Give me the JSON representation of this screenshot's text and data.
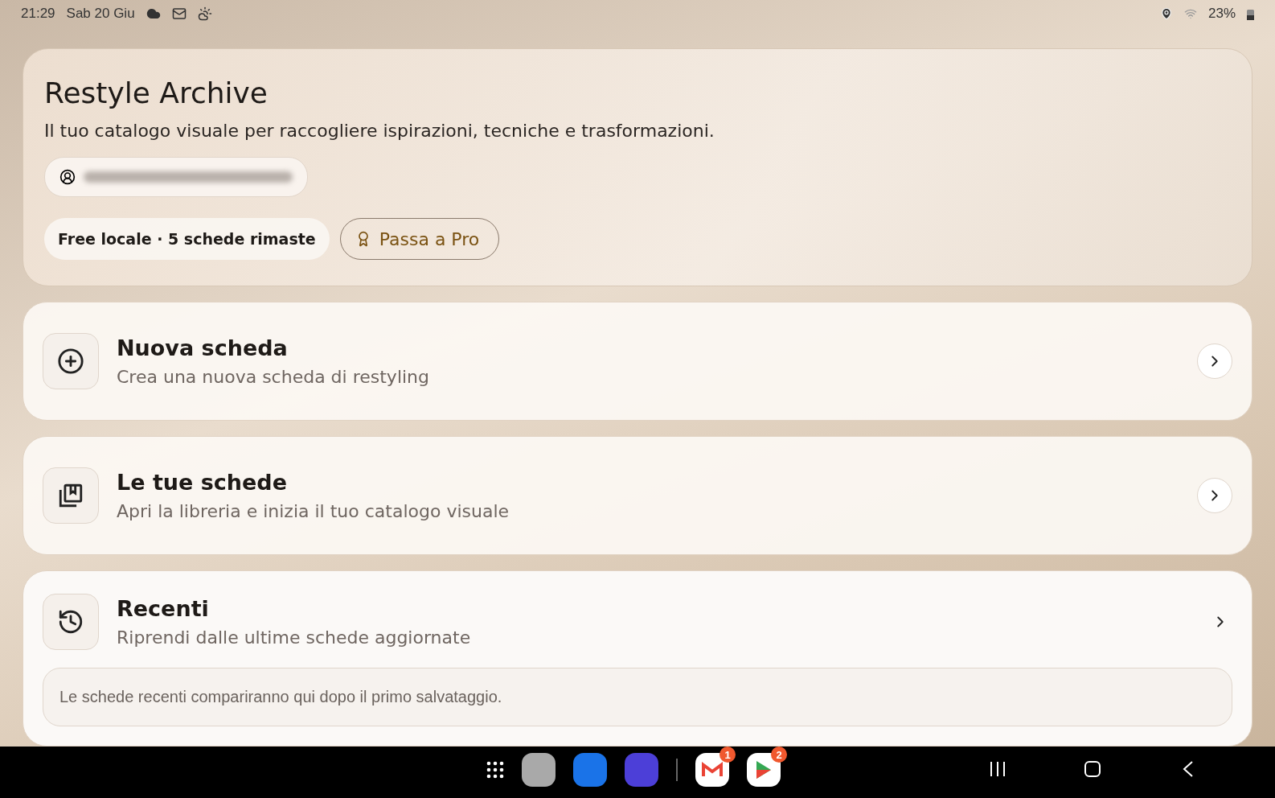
{
  "status_bar": {
    "time": "21:29",
    "date": "Sab 20 Giu",
    "battery": "23%"
  },
  "header": {
    "title": "Restyle Archive",
    "subtitle": "Il tuo catalogo visuale per raccogliere ispirazioni, tecniche e trasformazioni.",
    "plan": "Free locale · 5 schede rimaste",
    "upgrade_button": "Passa a Pro"
  },
  "menu": [
    {
      "kind": "link",
      "title": "Nuova scheda",
      "subtitle": "Crea una nuova scheda di restyling"
    },
    {
      "kind": "link",
      "title": "Le tue schede",
      "subtitle": "Apri la libreria e inizia il tuo catalogo visuale"
    },
    {
      "kind": "section",
      "title": "Recenti",
      "subtitle": "Riprendi dalle ultime schede aggiornate",
      "note": "Le schede recenti compariranno qui dopo il primo salvataggio."
    }
  ],
  "taskbar": {
    "badges": [
      {
        "count": "1"
      },
      {
        "count": "2"
      }
    ]
  }
}
